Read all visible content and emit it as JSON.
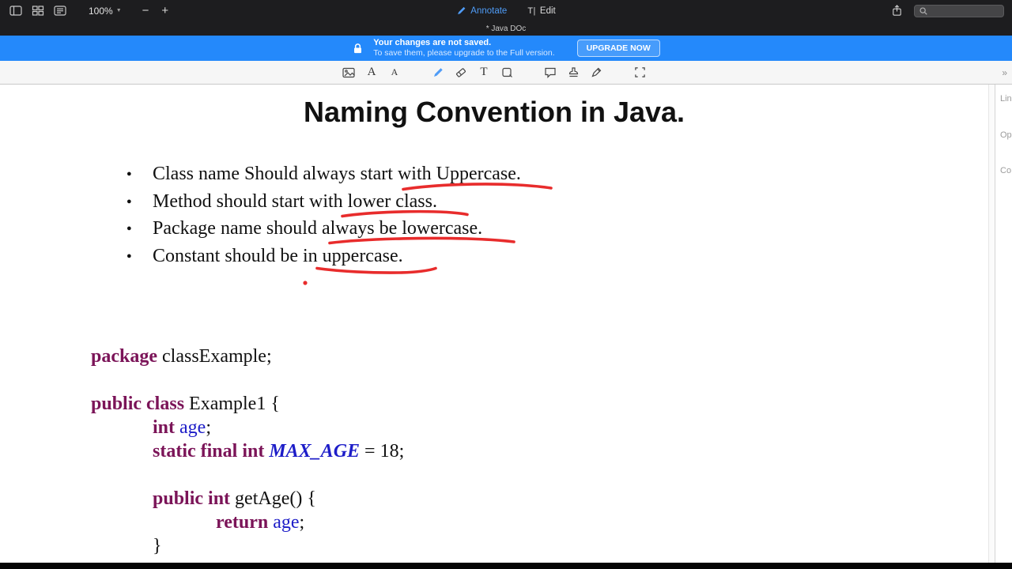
{
  "topbar": {
    "zoom_level": "100%",
    "zoom_out_label": "−",
    "zoom_in_label": "+",
    "annotate_label": "Annotate",
    "edit_icon_glyph": "T|",
    "edit_label": "Edit",
    "search": {
      "value": "",
      "placeholder": ""
    }
  },
  "window_title": "* Java DOc",
  "banner": {
    "title": "Your changes are not saved.",
    "subtitle": "To save them, please upgrade to the Full version.",
    "upgrade_button_label": "UPGRADE NOW"
  },
  "toolbar": {
    "text_large_label": "A",
    "text_small_label": "A",
    "text_tool_label": "T",
    "more_label": "»"
  },
  "page": {
    "title": "Naming Convention in Java.",
    "bullets": [
      "Class name Should always start with Uppercase.",
      "Method should start with lower class.",
      "Package name should always be lowercase.",
      "Constant should be in uppercase."
    ],
    "code": {
      "line1": {
        "kw": "package",
        "pl": " classExample;"
      },
      "line2": {
        "kw": "public class",
        "pl": " Example1 {"
      },
      "line3": {
        "kw": "int",
        "sp": " ",
        "id": "age",
        "pl": ";"
      },
      "line4": {
        "kw": "static final int",
        "sp": " ",
        "cn": "MAX_AGE",
        "pl": " = 18;"
      },
      "line5": {
        "kw": "public int",
        "pl": " getAge() {"
      },
      "line6": {
        "kw": "return",
        "sp": " ",
        "id": "age",
        "pl": ";"
      },
      "line7": {
        "pl": "}"
      }
    }
  },
  "right_panel": {
    "labels": [
      "Lin",
      "Op",
      "Co"
    ]
  },
  "colors": {
    "banner_blue": "#2489fb",
    "annotate_blue": "#4f9cf7",
    "ink_red": "#e82c2c",
    "code_keyword": "#7b1458",
    "code_identifier": "#1d1dc8"
  }
}
